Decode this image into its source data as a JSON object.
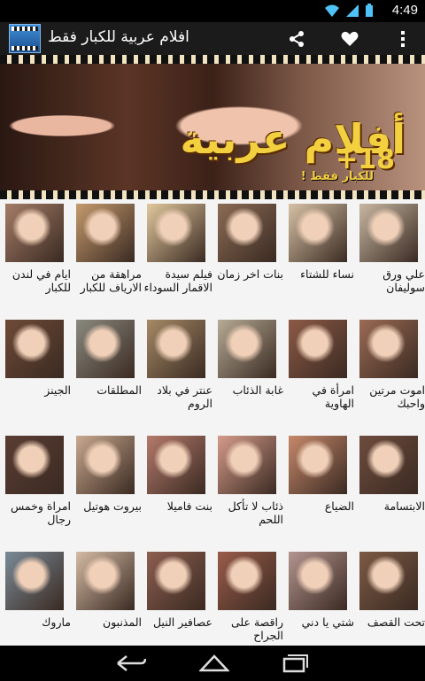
{
  "status": {
    "time": "4:49",
    "icons": [
      "wifi-icon",
      "signal-icon",
      "battery-icon"
    ]
  },
  "appbar": {
    "title": "افلام عربية للكبار فقط",
    "actions": [
      "share-icon",
      "heart-icon",
      "overflow-menu-icon"
    ]
  },
  "banner": {
    "title": "أفلام عربية",
    "plus": "+18",
    "caption": "للكبار فقط !"
  },
  "grid": {
    "rows": [
      [
        "علي ورق سوليفان",
        "نساء للشتاء",
        "بنات اخر زمان",
        "فيلم سيدة الاقمار السوداء",
        "مراهقة من الارياف للكبار",
        "ايام في لندن للكبار"
      ],
      [
        "اموت مرتين واحبك",
        "امرأة في الهاوية",
        "غابة الذئاب",
        "عنتر في بلاد الروم",
        "المطلقات",
        "الجينز"
      ],
      [
        "الابتسامة",
        "الضياع",
        "ذئاب لا تأكل اللحم",
        "بنت فاميلا",
        "بيروت هوتيل",
        "امراة وخمس رجال"
      ],
      [
        "تحت القصف",
        "شتي يا دني",
        "راقصة على الجراح",
        "عصافير النيل",
        "المذنبون",
        "ماروك"
      ]
    ],
    "thumb_colors": [
      [
        "#c7b7a2",
        "#d7c2a6",
        "#8b6c55",
        "#e1c89d",
        "#c59a6d",
        "#a47c67"
      ],
      [
        "#9b6b55",
        "#8d5a47",
        "#b7ab96",
        "#a58a66",
        "#8b8a80",
        "#6e4a37"
      ],
      [
        "#6e4c3e",
        "#c7896b",
        "#d59b8a",
        "#b57a6c",
        "#c9a98f",
        "#5a3d33"
      ],
      [
        "#7d5a45",
        "#b4958f",
        "#9a5c4a",
        "#8d5f50",
        "#d4bba5",
        "#7a8a97"
      ]
    ]
  },
  "navbar": {
    "buttons": [
      "back-icon",
      "home-icon",
      "recent-apps-icon"
    ]
  }
}
